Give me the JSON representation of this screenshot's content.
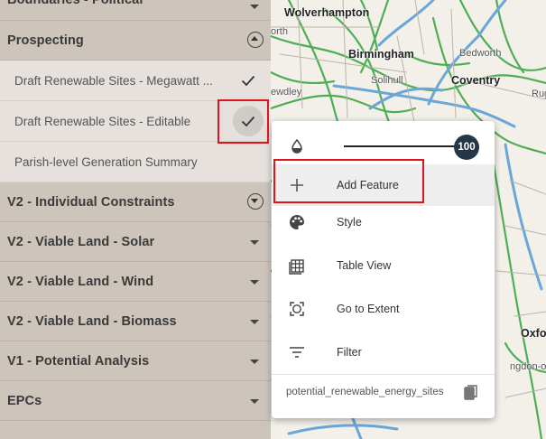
{
  "sidebar": {
    "groups_top": [
      {
        "title": "Boundaries - Political"
      }
    ],
    "prospecting": {
      "title": "Prospecting",
      "items": [
        {
          "label": "Draft Renewable Sites - Megawatt ..."
        },
        {
          "label": "Draft Renewable Sites - Editable"
        },
        {
          "label": "Parish-level Generation Summary"
        }
      ]
    },
    "groups": [
      {
        "title": "V2 - Individual Constraints"
      },
      {
        "title": "V2 - Viable Land - Solar"
      },
      {
        "title": "V2 - Viable Land - Wind"
      },
      {
        "title": "V2 - Viable Land - Biomass"
      },
      {
        "title": "V1 - Potential Analysis"
      },
      {
        "title": "EPCs"
      }
    ]
  },
  "map": {
    "labels": {
      "wolverhampton": "Wolverhampton",
      "birmingham": "Birmingham",
      "bedworth": "Bedworth",
      "coventry": "Coventry",
      "solihull": "Solihull",
      "rugby": "Rugby",
      "oxford": "Oxfo",
      "abingdon": "ngdon-on",
      "orth": "orth",
      "ewdley": "ewdley"
    }
  },
  "popup": {
    "opacity_value": "100",
    "opacity_level": 1.0,
    "menu": [
      {
        "label": "Add Feature",
        "icon": "plus-icon"
      },
      {
        "label": "Style",
        "icon": "palette-icon"
      },
      {
        "label": "Table View",
        "icon": "table-icon"
      },
      {
        "label": "Go to Extent",
        "icon": "extent-icon"
      },
      {
        "label": "Filter",
        "icon": "filter-icon"
      }
    ],
    "layer_name": "potential_renewable_energy_sites"
  },
  "colors": {
    "sidebar_bg": "#cdc4bc",
    "sub_item_bg": "#e6e1dc",
    "slider_knob": "#253746",
    "highlight": "#e0141e"
  }
}
